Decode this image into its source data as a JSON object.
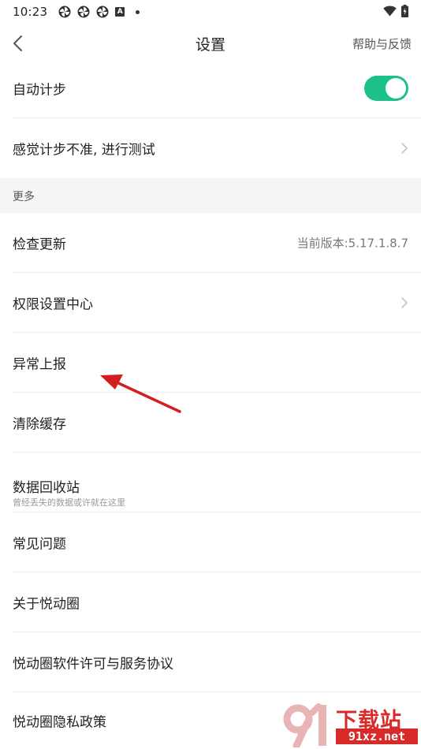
{
  "status_bar": {
    "time": "10:23",
    "a_badge": "A"
  },
  "nav": {
    "title": "设置",
    "help": "帮助与反馈"
  },
  "settings": {
    "auto_step": {
      "label": "自动计步",
      "enabled": true
    },
    "step_test": {
      "label": "感觉计步不准, 进行测试"
    }
  },
  "more_section": {
    "header": "更多",
    "check_update": {
      "label": "检查更新",
      "value": "当前版本:5.17.1.8.7"
    },
    "permissions": {
      "label": "权限设置中心"
    },
    "report": {
      "label": "异常上报"
    },
    "clear_cache": {
      "label": "清除缓存"
    },
    "recycle_bin": {
      "label": "数据回收站",
      "sublabel": "曾经丢失的数据或许就在这里"
    },
    "faq": {
      "label": "常见问题"
    },
    "about": {
      "label": "关于悦动圈"
    },
    "license": {
      "label": "悦动圈软件许可与服务协议"
    },
    "privacy": {
      "label": "悦动圈隐私政策"
    }
  },
  "watermark": {
    "cn": "下载站",
    "url": "91xz.net"
  },
  "colors": {
    "toggle_on": "#1dbf8a",
    "arrow": "#d41e1e",
    "watermark_red": "#d92a2a"
  }
}
